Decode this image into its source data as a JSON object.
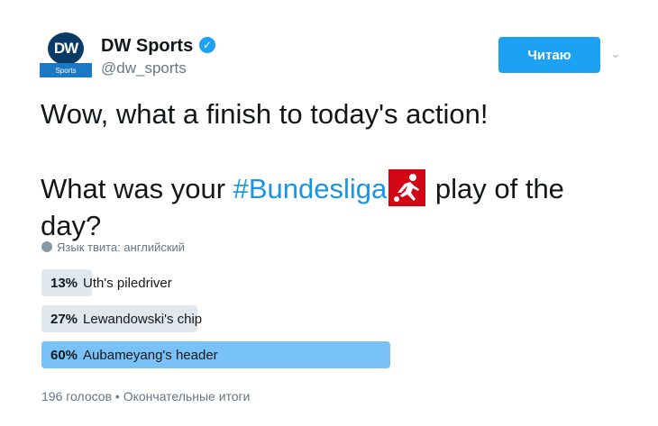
{
  "account": {
    "name": "DW Sports",
    "handle": "@dw_sports",
    "avatar_text": "DW",
    "avatar_sub": "Sports",
    "verified_icon": "✓",
    "follow_label": "Читаю",
    "more_icon": "⌄"
  },
  "tweet": {
    "line1": "Wow, what a finish to today's action!",
    "line2_pre": "What was your ",
    "hashtag": "#Bundesliga",
    "line2_post": " play of the day?"
  },
  "language_note": "Язык твита: английский",
  "poll": {
    "options": [
      {
        "percent_label": "13%",
        "percent": 13,
        "label": "Uth's piledriver"
      },
      {
        "percent_label": "27%",
        "percent": 27,
        "label": "Lewandowski's chip"
      },
      {
        "percent_label": "60%",
        "percent": 60,
        "label": "Aubameyang's header"
      }
    ],
    "votes": "196 голосов",
    "separator": "•",
    "status": "Окончательные итоги"
  },
  "colors": {
    "accent": "#1da1f2",
    "hashtag": "#1b95e0",
    "winner_bar": "#79c2f7",
    "bar": "#e1e8ed",
    "bundesliga_red": "#d20515"
  }
}
